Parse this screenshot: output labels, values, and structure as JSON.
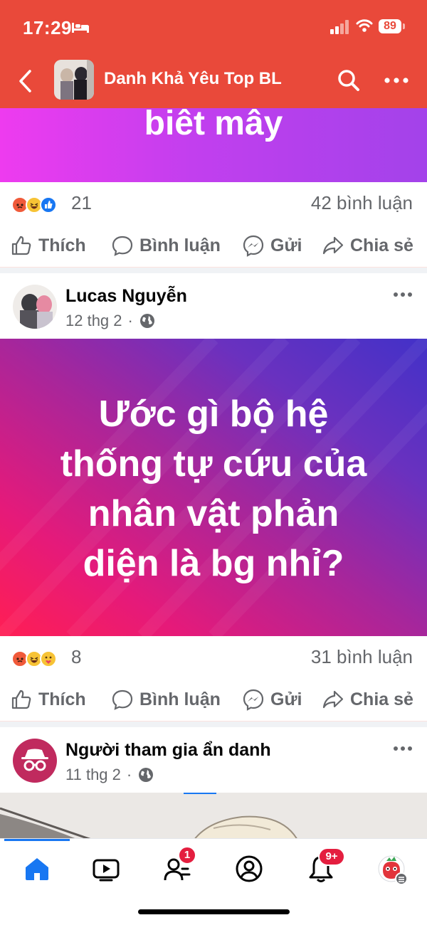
{
  "status_bar": {
    "time": "17:29",
    "battery": "89"
  },
  "header": {
    "group_name": "Danh Khả Yêu Top BL"
  },
  "post1": {
    "banner_text": "biêt mây",
    "reaction_count": "21",
    "comment_count": "42 bình luận"
  },
  "actions": {
    "like": "Thích",
    "comment": "Bình luận",
    "send": "Gửi",
    "share": "Chia sẻ"
  },
  "post2": {
    "author": "Lucas Nguyễn",
    "date": "12 thg 2",
    "dot": "·",
    "banner_lines": [
      "Ước gì bộ hệ",
      "thống tự cứu của",
      "nhân vật phản",
      "diện là bg nhỉ?"
    ],
    "reaction_count": "8",
    "comment_count": "31 bình luận"
  },
  "post3": {
    "author": "Người tham gia ẩn danh",
    "date": "11 thg 2",
    "dot": "·"
  },
  "tabbar": {
    "friends_badge": "1",
    "notifications_badge": "9+"
  },
  "colors": {
    "brand": "#e9493a",
    "accent": "#1877f2",
    "badge": "#e41e3f",
    "anonymous_avatar": "#c02a5e"
  }
}
